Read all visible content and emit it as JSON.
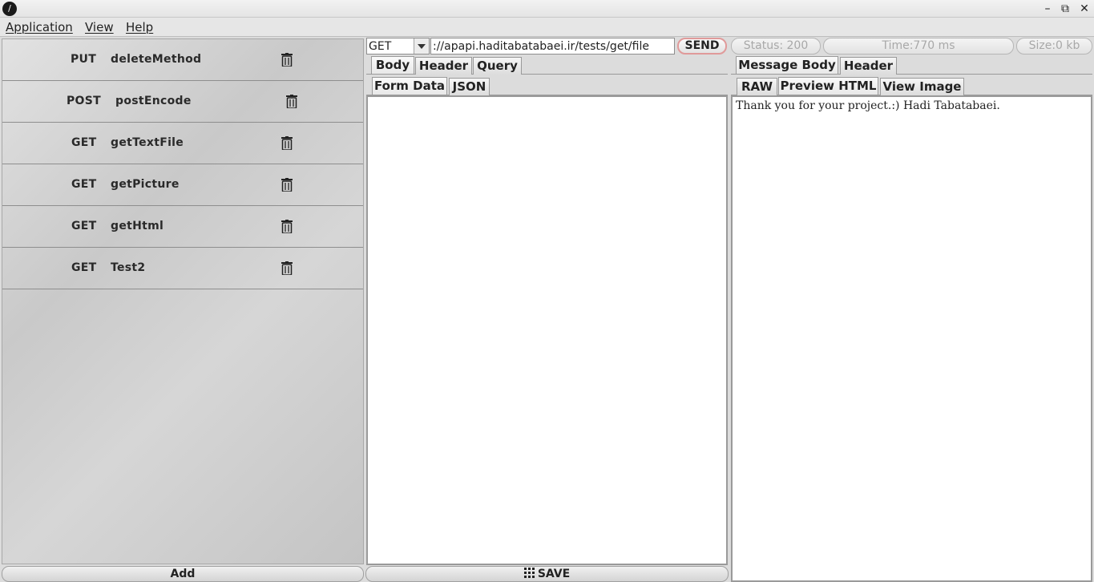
{
  "window": {
    "app_icon_glyph": "/",
    "minimize_glyph": "–",
    "maximize_glyph": "⧉",
    "close_glyph": "✕"
  },
  "menu": {
    "application": "Application",
    "view": "View",
    "help": "Help"
  },
  "sidebar": {
    "requests": [
      {
        "method": "PUT",
        "name": "deleteMethod",
        "icon": "trash-icon"
      },
      {
        "method": "POST",
        "name": "postEncode",
        "icon": "trash-icon"
      },
      {
        "method": "GET",
        "name": "getTextFile",
        "icon": "trash-icon"
      },
      {
        "method": "GET",
        "name": "getPicture",
        "icon": "trash-icon"
      },
      {
        "method": "GET",
        "name": "getHtml",
        "icon": "trash-icon"
      },
      {
        "method": "GET",
        "name": "Test2",
        "icon": "trash-icon"
      }
    ],
    "add_label": "Add"
  },
  "request": {
    "method": "GET",
    "url": "://apapi.haditabatabaei.ir/tests/get/file",
    "send_label": "SEND",
    "tabs": [
      "Body",
      "Header",
      "Query"
    ],
    "body_tabs": [
      "Form Data",
      "JSON"
    ],
    "save_label": "SAVE"
  },
  "response": {
    "status": "Status: 200",
    "time": "Time:770 ms",
    "size": "Size:0 kb",
    "tabs": [
      "Message Body",
      "Header"
    ],
    "view_tabs": [
      "RAW",
      "Preview HTML",
      "View Image"
    ],
    "body_text": "Thank you for your project.:) Hadi Tabatabaei."
  },
  "colors": {
    "send_border": "#e09a9a",
    "disabled_text": "#a8a8a8"
  }
}
